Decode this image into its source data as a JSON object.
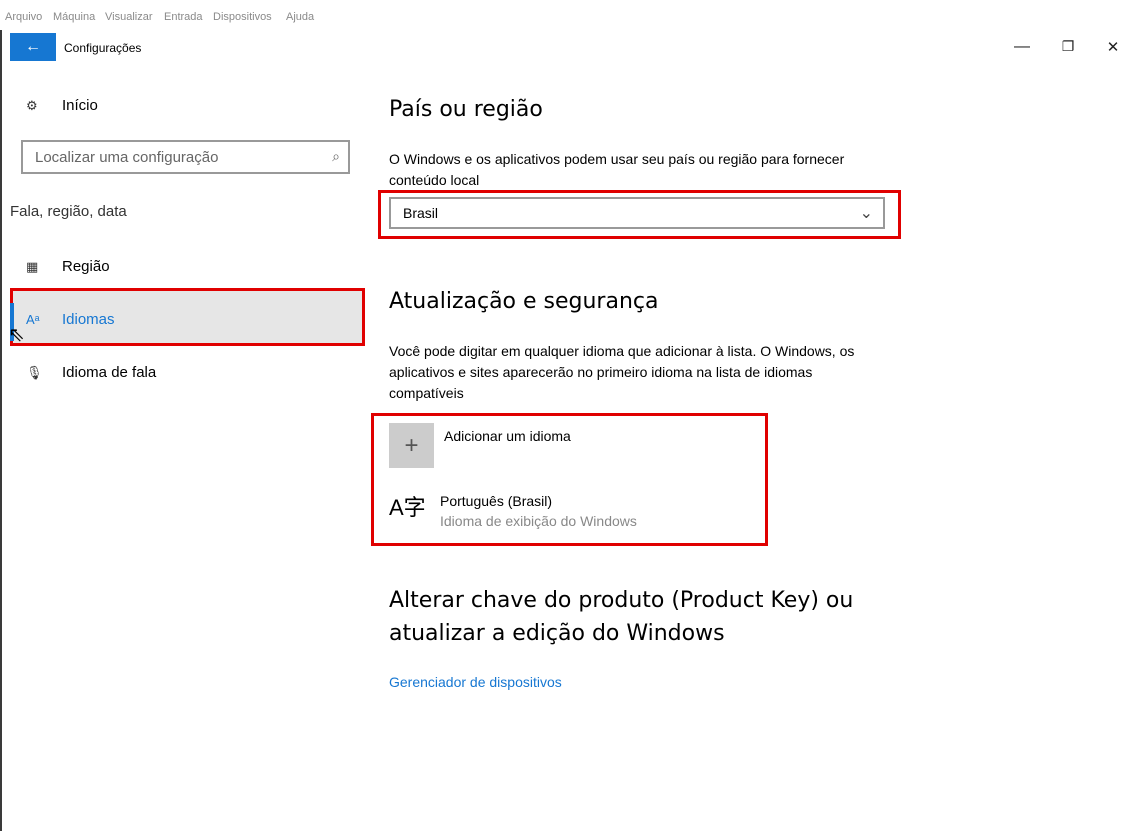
{
  "vm_menu": [
    "Arquivo",
    "Máquina",
    "Visualizar",
    "Entrada",
    "Dispositivos",
    "Ajuda"
  ],
  "window": {
    "title": "Configurações",
    "controls": {
      "minimize": "—",
      "restore": "❐",
      "close": "✕"
    },
    "back": "←"
  },
  "sidebar": {
    "home": "Início",
    "search_placeholder": "Localizar uma configuração",
    "section": "Fala, região, data",
    "items": [
      {
        "label": "Região",
        "icon": "region-calendar-icon",
        "selected": false
      },
      {
        "label": "Idiomas",
        "icon": "language-icon",
        "selected": true
      },
      {
        "label": "Idioma de fala",
        "icon": "microphone-icon",
        "selected": false
      }
    ]
  },
  "main": {
    "country": {
      "heading": "País ou região",
      "description": "O Windows e os aplicativos podem usar seu país ou região para fornecer conteúdo local",
      "selected": "Brasil"
    },
    "update": {
      "heading": "Atualização e segurança",
      "description": "Você pode digitar em qualquer idioma que adicionar à lista. O Windows, os aplicativos e sites aparecerão no primeiro idioma na lista de idiomas compatíveis",
      "add_language": "Adicionar um idioma",
      "language": {
        "name": "Português (Brasil)",
        "sub": "Idioma de exibição do Windows"
      }
    },
    "product_key": {
      "heading": "Alterar chave do produto (Product Key) ou atualizar a edição do Windows",
      "link": "Gerenciador de dispositivos"
    }
  },
  "colors": {
    "accent": "#1677d2",
    "highlight_red": "#e00000"
  }
}
